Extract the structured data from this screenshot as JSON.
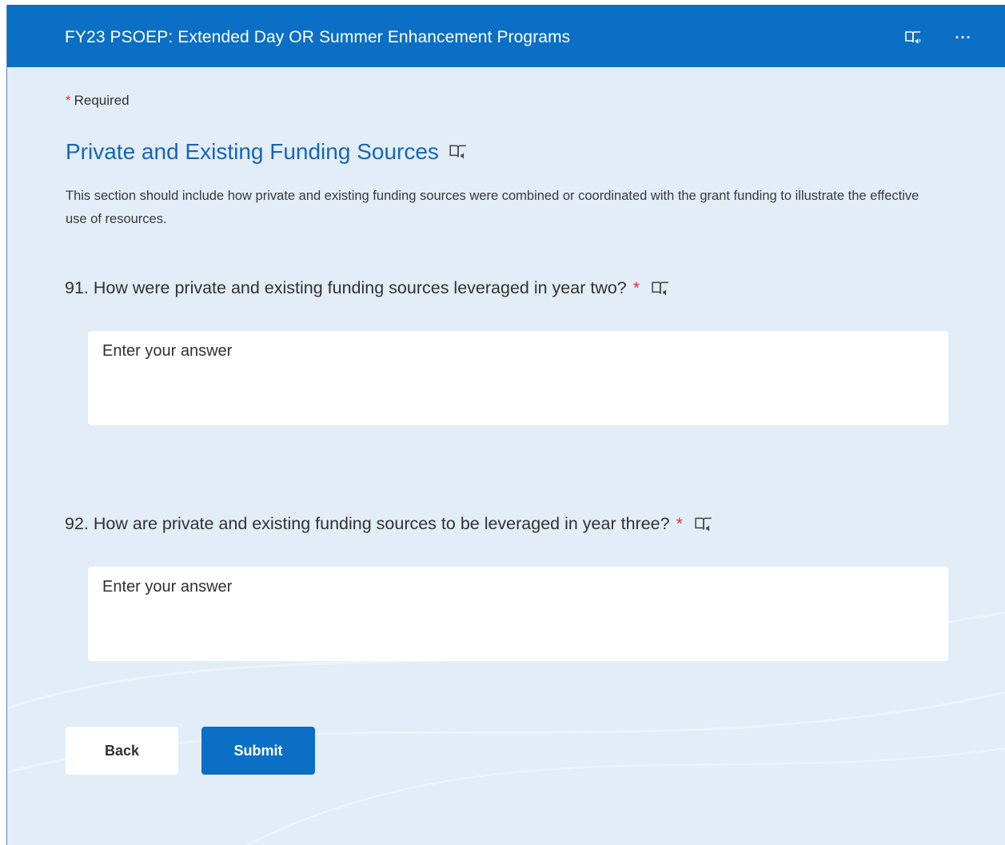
{
  "header": {
    "title": "FY23 PSOEP: Extended Day OR Summer Enhancement Programs",
    "reader_icon": "immersive-reader-icon",
    "more_icon": "more-options-icon",
    "more_glyph": "···"
  },
  "form": {
    "required_star": "*",
    "required_label": "Required",
    "section_title": "Private and Existing Funding Sources",
    "section_description": "This section should include how private and existing funding sources were combined or coordinated with the grant funding to illustrate the effective use of resources.",
    "questions": [
      {
        "number": "91.",
        "text": "How were private and existing funding sources leveraged in year two?",
        "required_star": "*",
        "placeholder": "Enter your answer"
      },
      {
        "number": "92.",
        "text": "How are private and existing funding sources to be leveraged in year three?",
        "required_star": "*",
        "placeholder": "Enter your answer"
      }
    ],
    "back_label": "Back",
    "submit_label": "Submit"
  },
  "colors": {
    "header_bg": "#0b6fc6",
    "page_bg": "#e3edf8",
    "accent_title": "#1766b4",
    "required_star": "#d13438"
  }
}
